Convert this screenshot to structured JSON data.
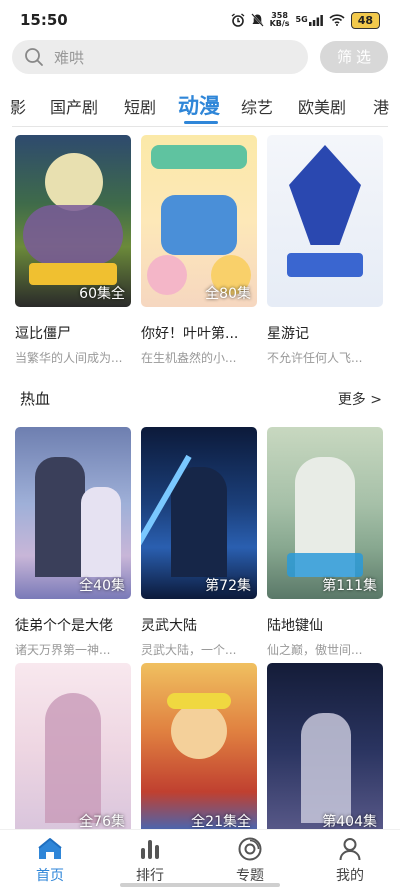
{
  "status_bar": {
    "time": "15:50",
    "net_speed_value": "358",
    "net_speed_unit": "KB/s",
    "signal": "5G",
    "battery": "48"
  },
  "search": {
    "placeholder": "难哄",
    "filter_label": "筛选"
  },
  "tabs": [
    {
      "label": "影"
    },
    {
      "label": "国产剧"
    },
    {
      "label": "短剧"
    },
    {
      "label": "动漫"
    },
    {
      "label": "综艺"
    },
    {
      "label": "欧美剧"
    },
    {
      "label": "港"
    }
  ],
  "active_tab": "动漫",
  "top_row": [
    {
      "title": "逗比僵尸",
      "desc": "当繁华的人间成为...",
      "badge": "60集全"
    },
    {
      "title": "你好！叶叶第...",
      "desc": "在生机盎然的小...",
      "badge": "全80集"
    },
    {
      "title": "星游记",
      "desc": "不允许任何人飞...",
      "badge": ""
    }
  ],
  "section": {
    "name": "热血",
    "more_label": "更多 >"
  },
  "hot_row1": [
    {
      "title": "徒弟个个是大佬",
      "desc": "诸天万界第一神...",
      "badge": "全40集"
    },
    {
      "title": "灵武大陆",
      "desc": "灵武大陆，一个...",
      "badge": "第72集"
    },
    {
      "title": "陆地键仙",
      "desc": "仙之巅，傲世间...",
      "badge": "第111集"
    }
  ],
  "hot_row2": [
    {
      "badge": "全76集"
    },
    {
      "badge": "全21集全"
    },
    {
      "badge": "第404集"
    }
  ],
  "nav": [
    {
      "label": "首页",
      "icon": "home-icon"
    },
    {
      "label": "排行",
      "icon": "ranking-icon"
    },
    {
      "label": "专题",
      "icon": "topic-icon"
    },
    {
      "label": "我的",
      "icon": "profile-icon"
    }
  ],
  "colors": {
    "accent": "#2f86d8"
  }
}
